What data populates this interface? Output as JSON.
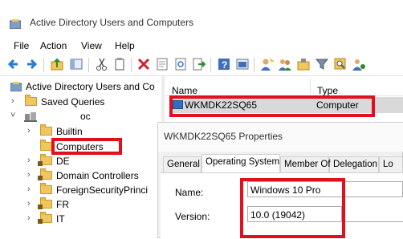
{
  "window": {
    "title": "Active Directory Users and Computers"
  },
  "menu": [
    "File",
    "Action",
    "View",
    "Help"
  ],
  "toolbar": {
    "icons": [
      "back-arrow-icon",
      "forward-arrow-icon",
      "up-folder-icon",
      "show-hide-tree-icon",
      "cut-icon",
      "copy-icon",
      "delete-icon",
      "properties-icon",
      "refresh-icon",
      "export-icon",
      "help-icon",
      "console-icon",
      "new-user-icon",
      "new-group-icon",
      "new-ou-icon",
      "filter-icon",
      "find-icon",
      "add-to-group-icon"
    ]
  },
  "tree": {
    "root": "Active Directory Users and Co",
    "saved_queries": "Saved Queries",
    "domain": "oc",
    "items": [
      "Builtin",
      "Computers",
      "DE",
      "Domain Controllers",
      "ForeignSecurityPrinci",
      "FR",
      "IT"
    ]
  },
  "list": {
    "columns": {
      "name": "Name",
      "type": "Type"
    },
    "rows": [
      {
        "name": "WKMDK22SQ65",
        "type": "Computer"
      }
    ]
  },
  "dialog": {
    "title": "WKMDK22SQ65 Properties",
    "tabs": [
      "General",
      "Operating System",
      "Member Of",
      "Delegation",
      "Lo"
    ],
    "active_tab": "Operating System",
    "fields": {
      "name_label": "Name:",
      "name_value": "Windows 10 Pro",
      "version_label": "Version:",
      "version_value": "10.0 (19042)"
    }
  },
  "colors": {
    "highlight_box": "#e2101d",
    "selected_row": "#d9d9d9",
    "folder": "#f0c75e"
  }
}
